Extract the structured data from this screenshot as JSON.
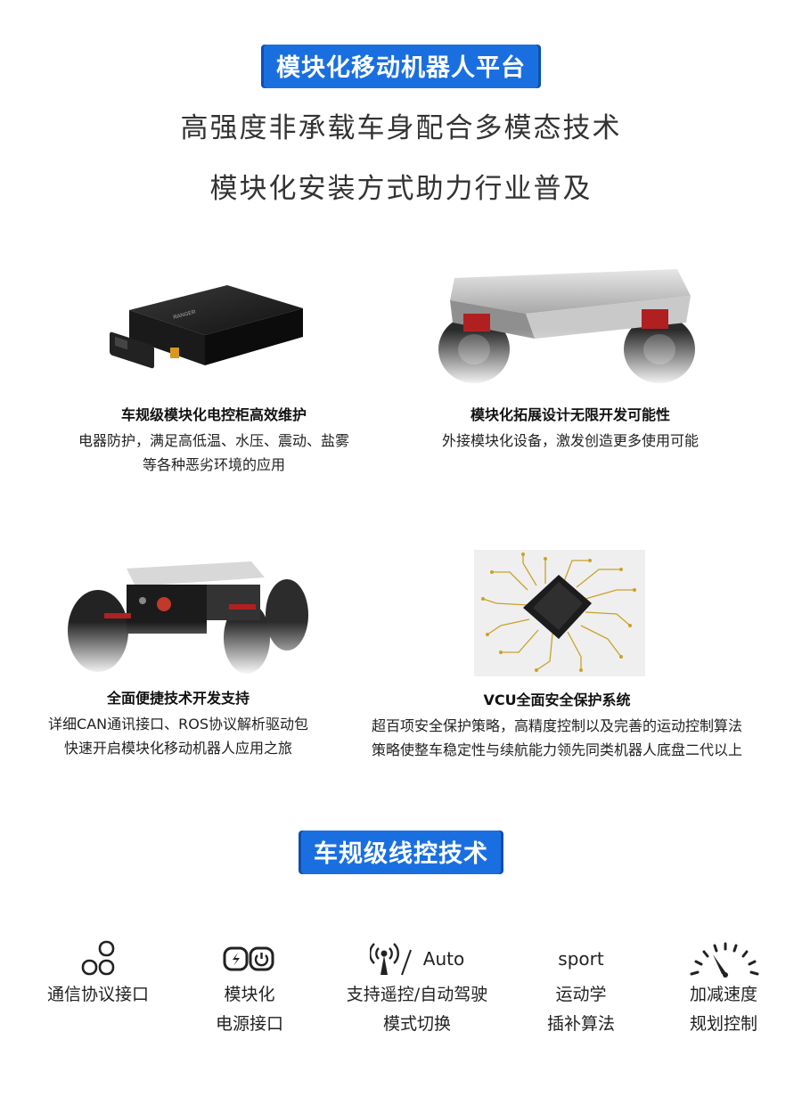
{
  "header": {
    "badge": "模块化移动机器人平台",
    "subtitle_1": "高强度非承载车身配合多模态技术",
    "subtitle_2": "模块化安装方式助力行业普及"
  },
  "features": [
    {
      "title": "车规级模块化电控柜高效维护",
      "lines": [
        "电器防护，满足高低温、水压、震动、盐雾",
        "等各种恶劣环境的应用"
      ]
    },
    {
      "title": "模块化拓展设计无限开发可能性",
      "lines": [
        "外接模块化设备，激发创造更多使用可能"
      ]
    },
    {
      "title": "全面便捷技术开发支持",
      "lines": [
        "详细CAN通讯接口、ROS协议解析驱动包",
        "快速开启模块化移动机器人应用之旅"
      ]
    },
    {
      "title": "VCU全面安全保护系统",
      "lines": [
        "超百项安全保护策略，高精度控制以及完善的运动控制算法",
        "策略使整车稳定性与续航能力领先同类机器人底盘二代以上"
      ]
    }
  ],
  "section2": {
    "badge": "车规级线控技术"
  },
  "tech_items": [
    {
      "icon": "circles-icon",
      "lines": [
        "通信协议接口"
      ]
    },
    {
      "icon": "power-module-icon",
      "lines": [
        "模块化",
        "电源接口"
      ]
    },
    {
      "icon": "remote-antenna-icon",
      "icon_text": "Auto",
      "lines": [
        "支持遥控/自动驾驶",
        "模式切换"
      ]
    },
    {
      "icon": "sport-icon",
      "icon_text": "sport",
      "lines": [
        "运动学",
        "插补算法"
      ]
    },
    {
      "icon": "speedometer-icon",
      "lines": [
        "加减速度",
        "规划控制"
      ]
    }
  ],
  "colors": {
    "accent": "#1a6fe0",
    "accent_dark": "#0d4fb0",
    "text": "#222222"
  }
}
